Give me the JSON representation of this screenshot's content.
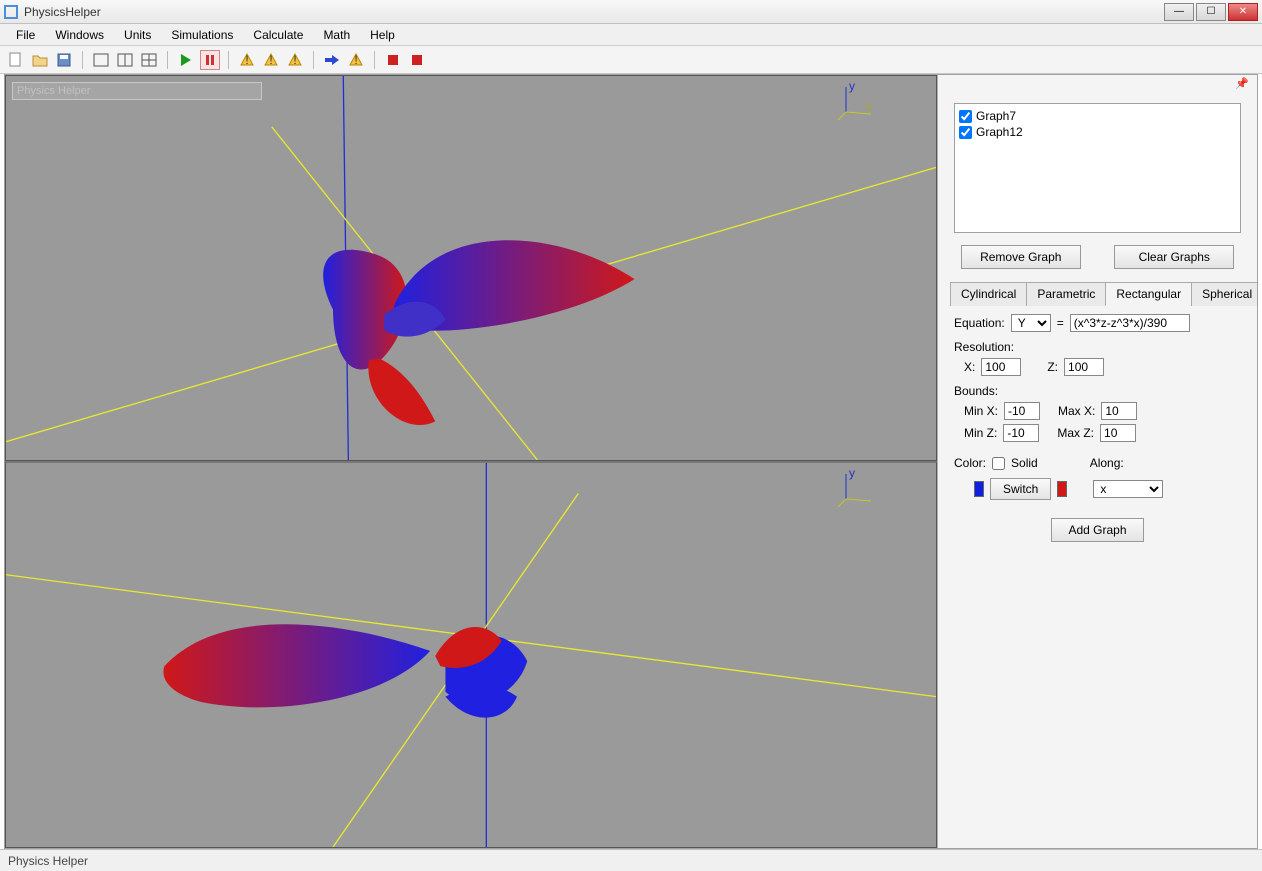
{
  "window": {
    "title": "PhysicsHelper"
  },
  "menu": {
    "items": [
      "File",
      "Windows",
      "Units",
      "Simulations",
      "Calculate",
      "Math",
      "Help"
    ]
  },
  "viewport_label": "Physics Helper",
  "sidebar": {
    "graphs": [
      {
        "name": "Graph7",
        "checked": true
      },
      {
        "name": "Graph12",
        "checked": true
      }
    ],
    "remove_label": "Remove Graph",
    "clear_label": "Clear Graphs",
    "tabs": [
      "Cylindrical",
      "Parametric",
      "Rectangular",
      "Spherical"
    ],
    "active_tab": "Rectangular",
    "equation_label": "Equation:",
    "equation_var": "Y",
    "equation_eq": "=",
    "equation_value": "(x^3*z-z^3*x)/390",
    "resolution_label": "Resolution:",
    "res_x_label": "X:",
    "res_x": "100",
    "res_z_label": "Z:",
    "res_z": "100",
    "bounds_label": "Bounds:",
    "minx_label": "Min X:",
    "minx": "-10",
    "maxx_label": "Max X:",
    "maxx": "10",
    "minz_label": "Min Z:",
    "minz": "-10",
    "maxz_label": "Max Z:",
    "maxz": "10",
    "color_label": "Color:",
    "solid_label": "Solid",
    "switch_label": "Switch",
    "along_label": "Along:",
    "along_value": "x",
    "add_label": "Add Graph"
  },
  "status": {
    "text": "Physics Helper"
  }
}
